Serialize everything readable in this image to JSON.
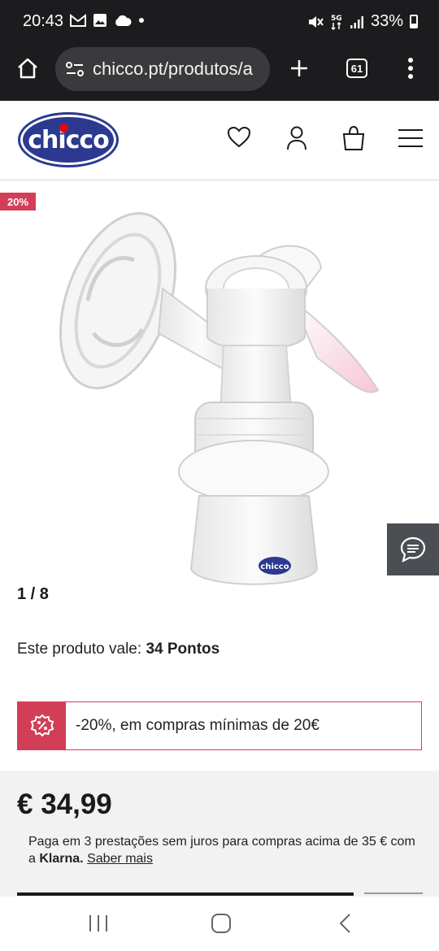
{
  "status": {
    "time": "20:43",
    "battery": "33%"
  },
  "browser": {
    "url": "chicco.pt/produtos/a",
    "tab_count": "61"
  },
  "site": {
    "logo_text": "chicco",
    "brand_color": "#2b3990",
    "accent_color": "#d33e57"
  },
  "product": {
    "discount_badge": "20%",
    "image_logo": "chicco",
    "pager": "1 / 8",
    "points_label": "Este produto vale:",
    "points_value": "34 Pontos",
    "promo_text": "-20%, em compras mínimas de 20€",
    "price": "€ 34,99",
    "klarna_text_1": "Paga em 3 prestações sem juros para compras acima de 35 € com a",
    "klarna_brand": "Klarna.",
    "klarna_link": "Saber mais"
  },
  "icons": {
    "home": "home-icon",
    "site_settings": "site-settings-icon",
    "new_tab": "plus-icon",
    "menu": "more-vertical-icon",
    "wishlist": "heart-icon",
    "account": "user-icon",
    "cart": "bag-icon",
    "hamburger": "hamburger-icon",
    "chat": "chat-icon",
    "promo": "percent-badge-icon"
  }
}
